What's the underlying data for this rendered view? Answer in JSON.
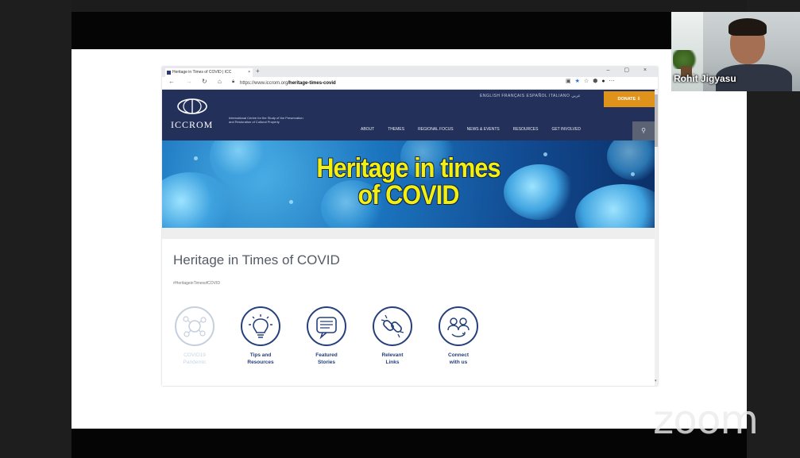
{
  "meeting": {
    "participant_name": "Rohit Jigyasu",
    "app_logo": "zoom"
  },
  "browser": {
    "tab_title": "Heritage in Times of COVID | ICC",
    "tab_close": "×",
    "new_tab": "+",
    "window_controls": "– ▢ ×",
    "url_host": "https://www.iccrom.org",
    "url_path": "/heritage-times-covid"
  },
  "site": {
    "languages": "ENGLISH  FRANÇAIS  ESPAÑOL  ITALIANO  عربي",
    "donate_label": "DONATE",
    "logo_word": "ICCROM",
    "logo_subtitle": "International Centre for the Study of the Preservation and Restoration of Cultural Property",
    "nav": [
      "ABOUT",
      "THEMES",
      "REGIONAL FOCUS",
      "NEWS & EVENTS",
      "RESOURCES",
      "GET INVOLVED"
    ],
    "hero_line1": "Heritage in times",
    "hero_line2": "of COVID",
    "page_title": "Heritage in Times of COVID",
    "hashtag": "#HeritageinTimesofCOVID",
    "features": [
      {
        "line1": "COVID19",
        "line2": "Pandemic",
        "icon": "virus-network-icon",
        "active": false
      },
      {
        "line1": "Tips and",
        "line2": "Resources",
        "icon": "lightbulb-icon",
        "active": true
      },
      {
        "line1": "Featured",
        "line2": "Stories",
        "icon": "speech-bubble-icon",
        "active": true
      },
      {
        "line1": "Relevant",
        "line2": "Links",
        "icon": "link-icon",
        "active": true
      },
      {
        "line1": "Connect",
        "line2": "with us",
        "icon": "people-connect-icon",
        "active": true
      }
    ]
  },
  "colors": {
    "header_navy": "#23305a",
    "donate_orange": "#e0931b",
    "hero_yellow": "#f4f00e",
    "icon_navy": "#25407a"
  }
}
